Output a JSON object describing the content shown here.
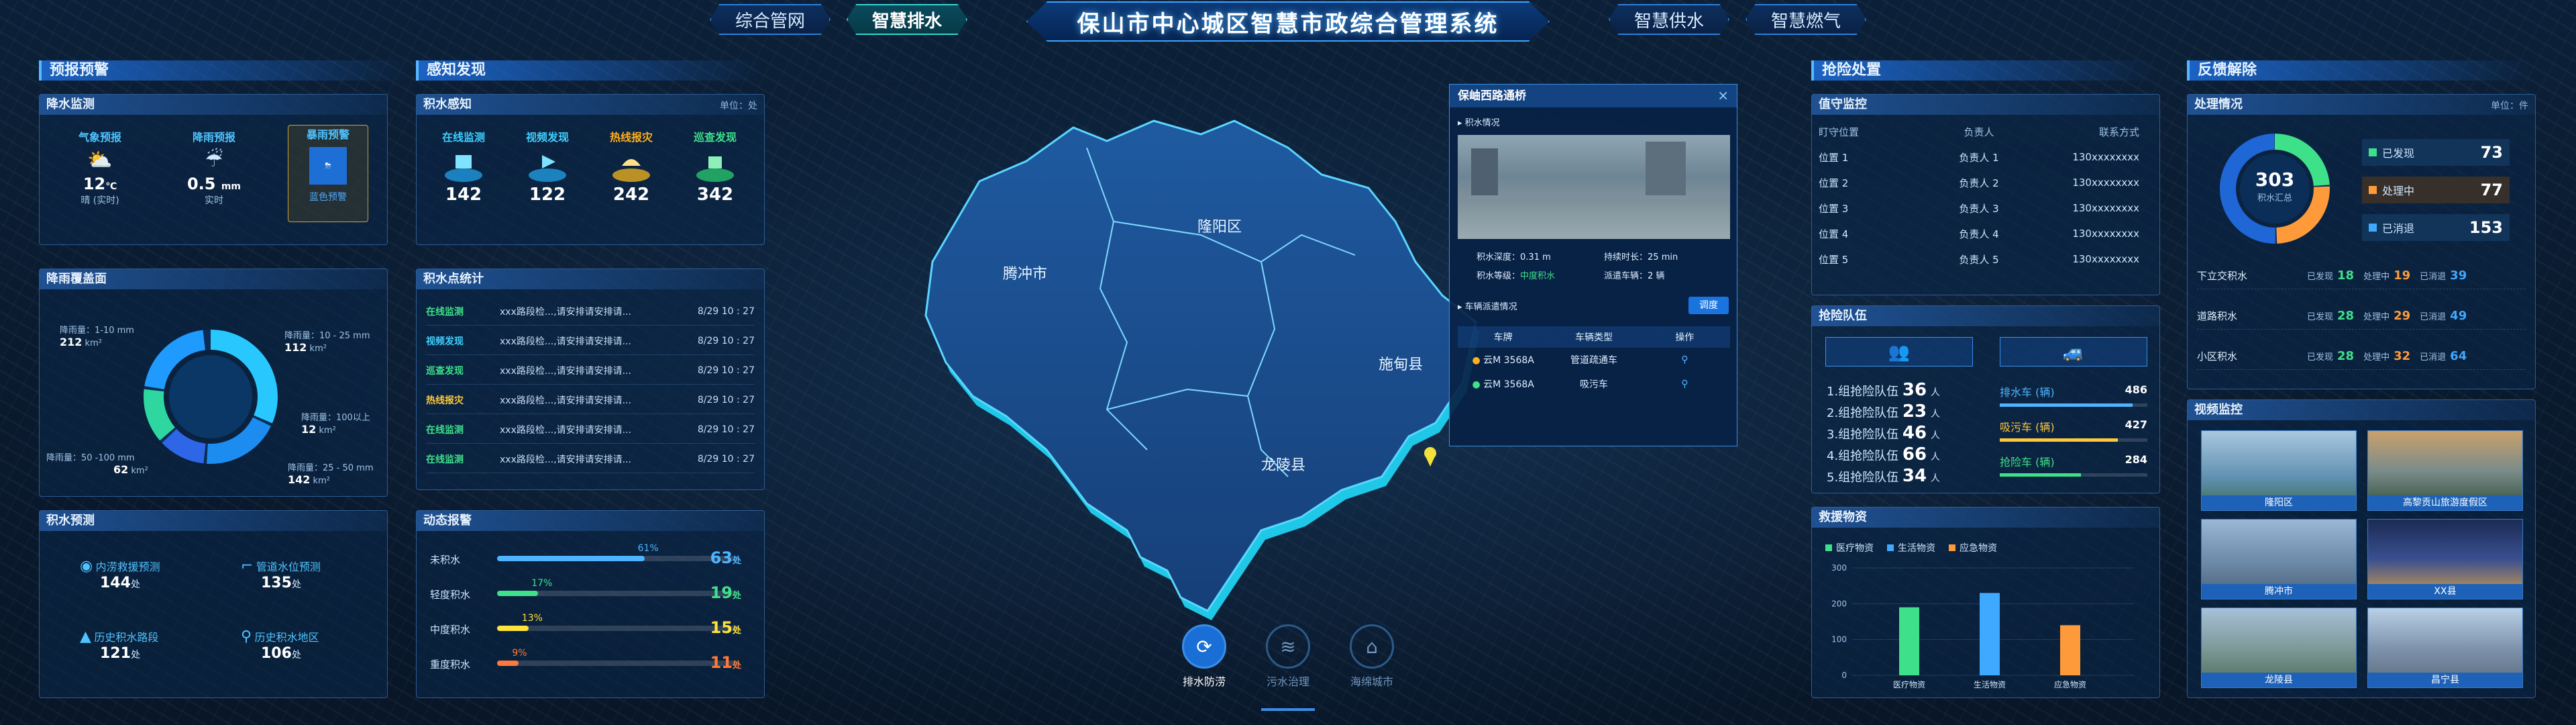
{
  "header": {
    "title": "保山市中心城区智慧市政综合管理系统",
    "nav_left": [
      "综合管网",
      "智慧排水"
    ],
    "nav_right": [
      "智慧供水",
      "智慧燃气"
    ]
  },
  "left1": {
    "title": "预报预警",
    "rain_monitor": {
      "title": "降水监测",
      "cells": [
        {
          "label": "气象预报",
          "value": "12",
          "unit": "℃",
          "foot": "晴 (实时)"
        },
        {
          "label": "降雨预报",
          "value": "0.5",
          "unit": "mm",
          "foot": "实时"
        },
        {
          "label": "暴雨预警",
          "value": "",
          "unit": "",
          "foot": "蓝色预警"
        }
      ]
    },
    "coverage": {
      "title": "降雨覆盖面",
      "labels": [
        {
          "text": "降雨量：1-10 mm",
          "val": "212",
          "unit": "km²"
        },
        {
          "text": "降雨量：10 - 25 mm",
          "val": "112",
          "unit": "km²"
        },
        {
          "text": "降雨量：100以上",
          "val": "12",
          "unit": "km²"
        },
        {
          "text": "降雨量：25 - 50 mm",
          "val": "142",
          "unit": "km²"
        },
        {
          "text": "降雨量：50 -100 mm",
          "val": "62",
          "unit": "km²"
        }
      ]
    },
    "forecast": {
      "title": "积水预测",
      "items": [
        {
          "label": "内涝救援预测",
          "value": "144",
          "unit": "处"
        },
        {
          "label": "管道水位预测",
          "value": "135",
          "unit": "处"
        },
        {
          "label": "历史积水路段",
          "value": "121",
          "unit": "处"
        },
        {
          "label": "历史积水地区",
          "value": "106",
          "unit": "处"
        }
      ]
    }
  },
  "left2": {
    "title": "感知发现",
    "perception": {
      "title": "积水感知",
      "unit": "单位：处",
      "items": [
        {
          "label": "在线监测",
          "value": "142",
          "color": "#3fd0ff"
        },
        {
          "label": "视频发现",
          "value": "122",
          "color": "#3fd0ff"
        },
        {
          "label": "热线报灾",
          "value": "242",
          "color": "#ffc83a"
        },
        {
          "label": "巡查发现",
          "value": "342",
          "color": "#3fe08a"
        }
      ]
    },
    "stats": {
      "title": "积水点统计",
      "rows": [
        {
          "tag": "在线监测",
          "text": "xxx路段检...,请安排请安排请...",
          "time": "8/29 10 : 27",
          "color": "#3fe08a"
        },
        {
          "tag": "视频发现",
          "text": "xxx路段检...,请安排请安排请...",
          "time": "8/29 10 : 27",
          "color": "#3fd0ff"
        },
        {
          "tag": "巡查发现",
          "text": "xxx路段检...,请安排请安排请...",
          "time": "8/29 10 : 27",
          "color": "#3fe08a"
        },
        {
          "tag": "热线报灾",
          "text": "xxx路段检...,请安排请安排请...",
          "time": "8/29 10 : 27",
          "color": "#ffc83a"
        },
        {
          "tag": "在线监测",
          "text": "xxx路段检...,请安排请安排请...",
          "time": "8/29 10 : 27",
          "color": "#3fe08a"
        },
        {
          "tag": "在线监测",
          "text": "xxx路段检...,请安排请安排请...",
          "time": "8/29 10 : 27",
          "color": "#3fe08a"
        }
      ]
    },
    "alarm": {
      "title": "动态报警",
      "items": [
        {
          "label": "未积水",
          "pct": "61%",
          "value": "63",
          "unit": "处",
          "fill": 0.61,
          "color": "#4fb4ff"
        },
        {
          "label": "轻度积水",
          "pct": "17%",
          "value": "19",
          "unit": "处",
          "fill": 0.17,
          "color": "#3fe08a"
        },
        {
          "label": "中度积水",
          "pct": "13%",
          "value": "15",
          "unit": "处",
          "fill": 0.13,
          "color": "#ffe23a"
        },
        {
          "label": "重度积水",
          "pct": "9%",
          "value": "11",
          "unit": "处",
          "fill": 0.09,
          "color": "#ff7a3a"
        }
      ]
    }
  },
  "map": {
    "regions": [
      "腾冲市",
      "隆阳区",
      "施甸县",
      "龙陵县"
    ],
    "popup": {
      "title": "保岫西路通桥",
      "section1": "积水情况",
      "depth_label": "积水深度：",
      "depth": "0.31 m",
      "dur_label": "持续时长：",
      "dur": "25 min",
      "level_label": "积水等级：",
      "level": "中度积水",
      "dispatch_label": "派遣车辆：",
      "dispatch": "2 辆",
      "section2": "车辆派遣情况",
      "dispatch_btn": "调度",
      "cols": [
        "车牌",
        "车辆类型",
        "操作"
      ],
      "rows": [
        {
          "plate": "云M 3568A",
          "type": "管道疏通车"
        },
        {
          "plate": "云M 3568A",
          "type": "吸污车"
        }
      ]
    },
    "buttons": [
      "排水防涝",
      "污水治理",
      "海绵城市"
    ]
  },
  "right1": {
    "title": "抢险处置",
    "duty": {
      "title": "值守监控",
      "cols": [
        "盯守位置",
        "负责人",
        "联系方式"
      ],
      "rows": [
        {
          "pos": "位置 1",
          "who": "负责人 1",
          "tel": "130xxxxxxxx"
        },
        {
          "pos": "位置 2",
          "who": "负责人 2",
          "tel": "130xxxxxxxx"
        },
        {
          "pos": "位置 3",
          "who": "负责人 3",
          "tel": "130xxxxxxxx"
        },
        {
          "pos": "位置 4",
          "who": "负责人 4",
          "tel": "130xxxxxxxx"
        },
        {
          "pos": "位置 5",
          "who": "负责人 5",
          "tel": "130xxxxxxxx"
        }
      ]
    },
    "teams": {
      "title": "抢险队伍",
      "list": [
        {
          "label": "1.组抢险队伍",
          "value": "36",
          "unit": "人"
        },
        {
          "label": "2.组抢险队伍",
          "value": "23",
          "unit": "人"
        },
        {
          "label": "3.组抢险队伍",
          "value": "46",
          "unit": "人"
        },
        {
          "label": "4.组抢险队伍",
          "value": "66",
          "unit": "人"
        },
        {
          "label": "5.组抢险队伍",
          "value": "34",
          "unit": "人"
        }
      ],
      "vehicles": [
        {
          "label": "排水车 (辆)",
          "value": "486",
          "color": "#4fb4ff",
          "fill": 0.9
        },
        {
          "label": "吸污车 (辆)",
          "value": "427",
          "color": "#ffc83a",
          "fill": 0.8
        },
        {
          "label": "抢险车 (辆)",
          "value": "284",
          "color": "#3fe08a",
          "fill": 0.55
        }
      ]
    },
    "supplies": {
      "title": "救援物资",
      "legend": [
        {
          "name": "医疗物资",
          "color": "#3fe08a"
        },
        {
          "name": "生活物资",
          "color": "#3fa8ff"
        },
        {
          "name": "应急物资",
          "color": "#ff9a3a"
        }
      ],
      "ticks": [
        "0",
        "100",
        "200",
        "300"
      ],
      "categories": [
        "医疗物资",
        "生活物资",
        "应急物资"
      ]
    }
  },
  "chart_data": {
    "type": "bar",
    "categories": [
      "医疗物资",
      "生活物资",
      "应急物资"
    ],
    "values": [
      190,
      230,
      140
    ],
    "ylim": [
      0,
      300
    ],
    "title": "救援物资"
  },
  "right2": {
    "title": "反馈解除",
    "feedback": {
      "title": "处理情况",
      "unit": "单位：件",
      "center_value": "303",
      "center_label": "积水汇总",
      "stats": [
        {
          "label": "已发现",
          "value": "73",
          "color": "#3fe08a"
        },
        {
          "label": "处理中",
          "value": "77",
          "color": "#ff9a3a"
        },
        {
          "label": "已消退",
          "value": "153",
          "color": "#3fa8ff"
        }
      ],
      "rows": [
        {
          "name": "下立交积水",
          "found": "18",
          "doing": "19",
          "gone": "39"
        },
        {
          "name": "道路积水",
          "found": "28",
          "doing": "29",
          "gone": "49"
        },
        {
          "name": "小区积水",
          "found": "28",
          "doing": "32",
          "gone": "64"
        }
      ],
      "found_label": "已发现",
      "doing_label": "处理中",
      "gone_label": "已消退"
    },
    "video": {
      "title": "视频监控",
      "items": [
        "隆阳区",
        "高黎贡山旅游度假区",
        "腾冲市",
        "XX县",
        "龙陵县",
        "昌宁县"
      ]
    }
  }
}
